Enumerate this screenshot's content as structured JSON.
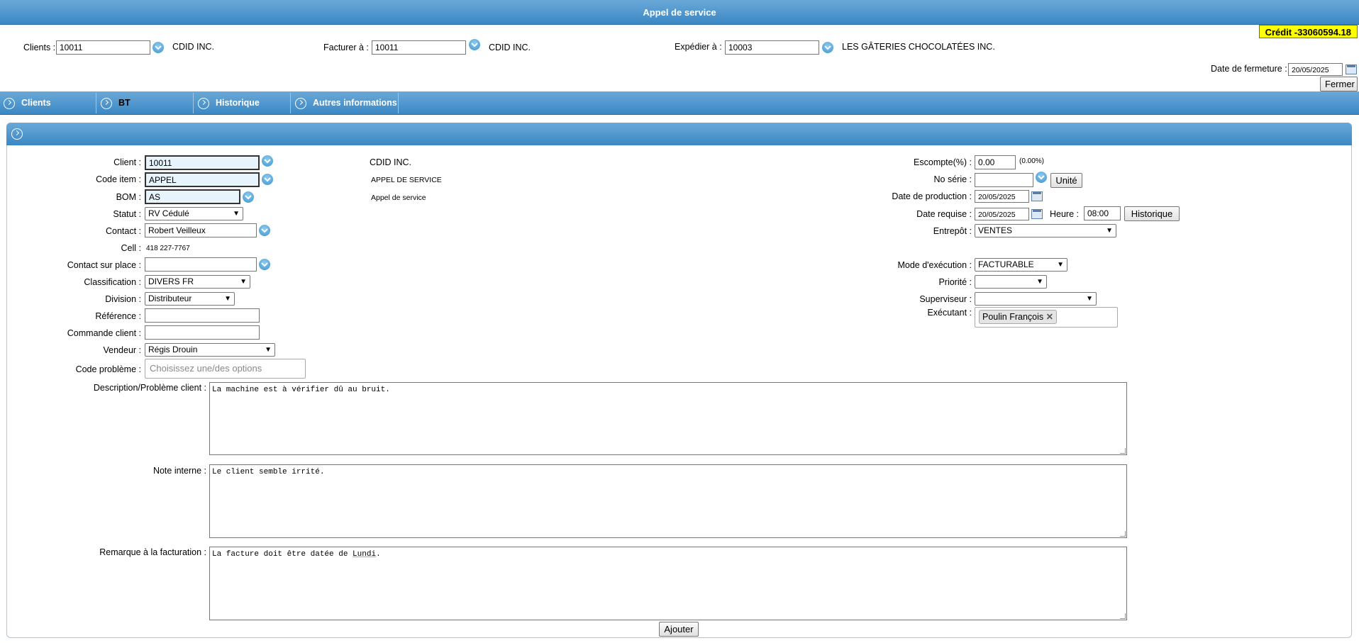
{
  "window": {
    "title": "Appel de service"
  },
  "credit": "Crédit -33060594.18",
  "header": {
    "clients_label": "Clients :",
    "clients_value": "10011",
    "clients_name": "CDID INC.",
    "facturer_label": "Facturer à :",
    "facturer_value": "10011",
    "facturer_name": "CDID INC.",
    "expedier_label": "Expédier à :",
    "expedier_value": "10003",
    "expedier_name": "LES GÂTERIES CHOCOLATÉES INC.",
    "closing_label": "Date de fermeture :",
    "closing_value": "20/05/2025",
    "close_button": "Fermer"
  },
  "tabs": [
    {
      "label": "Clients"
    },
    {
      "label": "BT"
    },
    {
      "label": "Historique"
    },
    {
      "label": "Autres informations"
    }
  ],
  "form": {
    "client_label": "Client :",
    "client_value": "10011",
    "client_name": "CDID INC.",
    "item_label": "Code item :",
    "item_value": "APPEL",
    "item_desc": "APPEL DE SERVICE",
    "bom_label": "BOM :",
    "bom_value": "AS",
    "bom_desc": "Appel de service",
    "statut_label": "Statut :",
    "statut_value": "RV Cédulé",
    "contact_label": "Contact :",
    "contact_value": "Robert Veilleux",
    "cell_label": "Cell :",
    "cell_value": "418 227-7767",
    "contact_place_label": "Contact sur place :",
    "contact_place_value": "",
    "classification_label": "Classification :",
    "classification_value": "DIVERS FR",
    "division_label": "Division :",
    "division_value": "Distributeur",
    "reference_label": "Référence :",
    "reference_value": "",
    "commande_label": "Commande client :",
    "commande_value": "",
    "vendeur_label": "Vendeur :",
    "vendeur_value": "Régis Drouin",
    "code_probleme_label": "Code problème :",
    "code_probleme_placeholder": "Choisissez une/des options",
    "escompte_label": "Escompte(%) :",
    "escompte_value": "0.00",
    "escompte_pct": "(0.00%)",
    "noserie_label": "No série :",
    "noserie_value": "",
    "unite_button": "Unité",
    "date_prod_label": "Date de production :",
    "date_prod_value": "20/05/2025",
    "date_req_label": "Date requise :",
    "date_req_value": "20/05/2025",
    "heure_label": "Heure :",
    "heure_value": "08:00",
    "historique_button": "Historique",
    "entrepot_label": "Entrepôt :",
    "entrepot_value": "VENTES",
    "mode_label": "Mode d'exécution :",
    "mode_value": "FACTURABLE",
    "priorite_label": "Priorité :",
    "priorite_value": "",
    "superviseur_label": "Superviseur :",
    "superviseur_value": "",
    "executant_label": "Exécutant :",
    "executant_tag": "Poulin François",
    "description_label": "Description/Problème client :",
    "description_value": "La machine est à vérifier dû au bruit.",
    "note_label": "Note interne :",
    "note_value": "Le client semble irrité.",
    "remarque_label": "Remarque à la facturation :",
    "remarque_prefix": "La facture doit être datée de ",
    "remarque_word": "Lundi",
    "remarque_suffix": ".",
    "add_button": "Ajouter"
  },
  "icons": {
    "dropdown": "dropdown-circle-icon",
    "calendar": "calendar-icon",
    "tab": "circle-arrow-right-icon",
    "remove": "close-icon"
  },
  "colors": {
    "header_blue": "#3b87c4",
    "credit_bg": "#ffff00",
    "field_blue": "#e8f4fb"
  }
}
